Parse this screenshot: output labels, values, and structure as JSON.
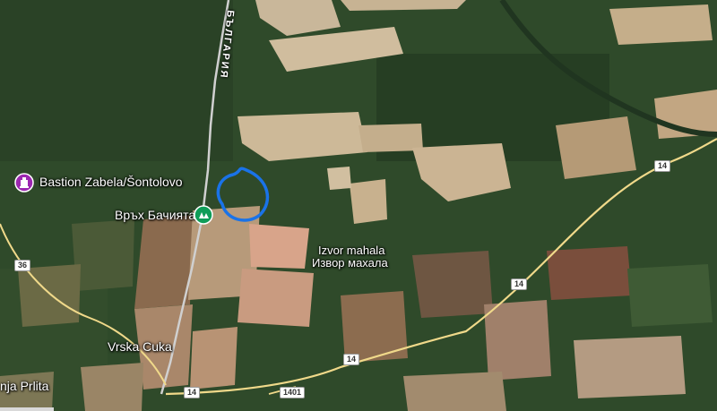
{
  "map": {
    "labels": {
      "bastion": "Bastion Zabela/Šontolovo",
      "peak": "Връх Бачията",
      "village_latin": "Izvor mahala",
      "village_cyrillic": "Извор махала",
      "town": "Vrska Cuka",
      "partial_town": "nja Prlita",
      "border": "БЪЛГАРИЯ"
    },
    "roads": {
      "r36": "36",
      "r14_a": "14",
      "r14_b": "14",
      "r14_c": "14",
      "r14_d": "14",
      "r1401": "1401"
    },
    "icons": {
      "bastion_pin": "monument-pin-icon",
      "peak_pin": "park-pin-icon"
    },
    "colors": {
      "forest": "#2f4a2a",
      "field_light": "#c9b79a",
      "field_pink": "#d8a48a",
      "field_brown": "#8a6a4e",
      "road": "#f0d98a",
      "border_line": "#d0d0d0",
      "route": "#1a73e8",
      "poi_purple": "#9c27b0",
      "poi_green": "#0f9d58"
    }
  }
}
